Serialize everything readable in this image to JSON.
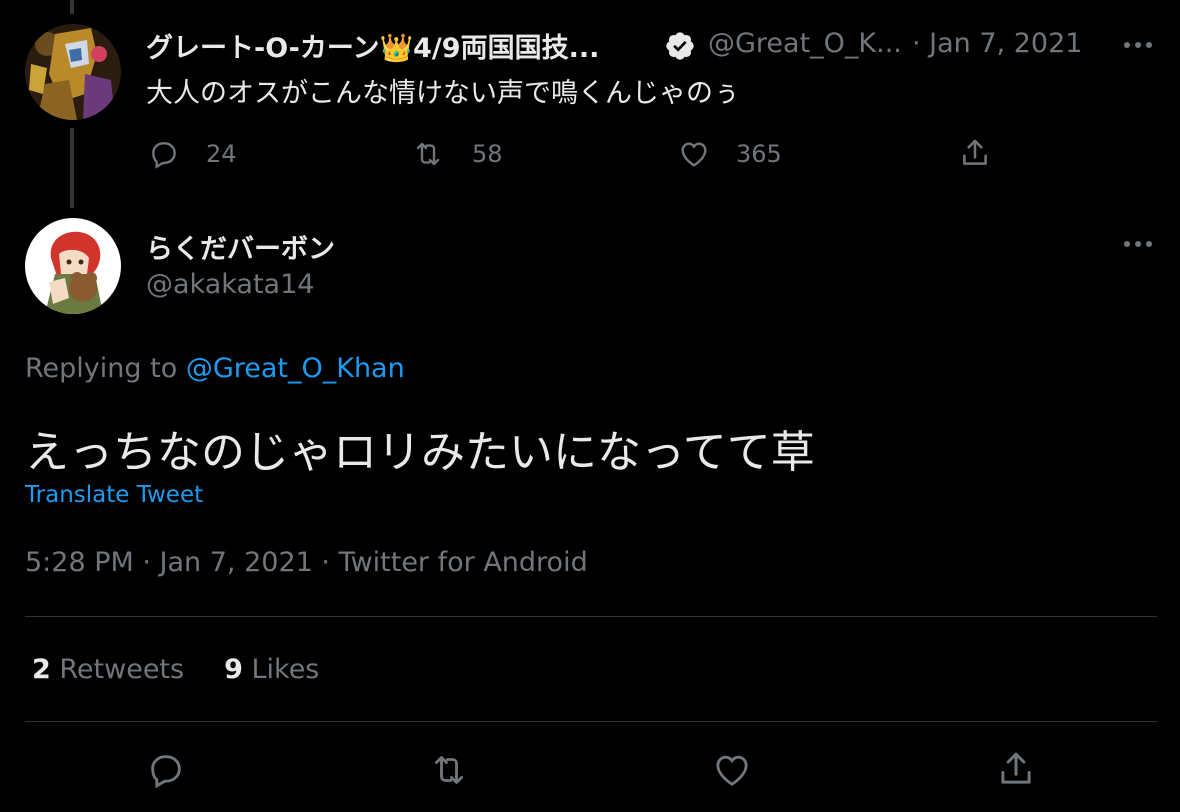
{
  "parent_tweet": {
    "display_name": "グレート-O-カーン👑4/9両国国技...",
    "handle": "@Great_O_K...",
    "date": "· Jan 7, 2021",
    "text": "大人のオスがこんな情けない声で鳴くんじゃのぅ",
    "replies": "24",
    "retweets": "58",
    "likes": "365",
    "verified_icon": "verified-badge-icon",
    "more_icon": "more-icon"
  },
  "main_tweet": {
    "display_name": "らくだバーボン",
    "handle": "@akakata14",
    "replying_prefix": "Replying to ",
    "replying_to": "@Great_O_Khan",
    "text": "えっちなのじゃロリみたいになってて草",
    "translate_label": "Translate Tweet",
    "timestamp": "5:28 PM · Jan 7, 2021 · Twitter for Android",
    "retweet_count": "2",
    "retweets_label": " Retweets",
    "like_count": "9",
    "likes_label": " Likes",
    "more_icon": "more-icon"
  },
  "action_bar": {
    "icons": [
      "reply-icon",
      "retweet-icon",
      "like-icon",
      "share-icon"
    ]
  },
  "colors": {
    "background": "#000000",
    "text": "#e7e9ea",
    "muted": "#71767b",
    "link": "#1d9bf0",
    "divider": "#2f3336"
  }
}
